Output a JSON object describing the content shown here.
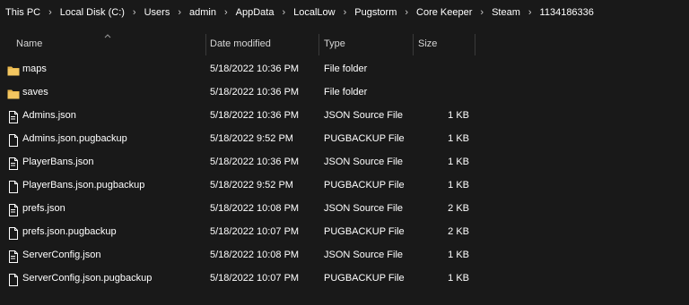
{
  "breadcrumb": [
    "This PC",
    "Local Disk (C:)",
    "Users",
    "admin",
    "AppData",
    "LocalLow",
    "Pugstorm",
    "Core Keeper",
    "Steam",
    "1134186336"
  ],
  "columns": {
    "name": "Name",
    "date": "Date modified",
    "type": "Type",
    "size": "Size"
  },
  "sort": {
    "column": "name",
    "direction": "ascending"
  },
  "colors": {
    "folder": "#e8b64c",
    "file_outline": "#ffffff",
    "background": "#191919"
  },
  "files": [
    {
      "name": "maps",
      "date": "5/18/2022 10:36 PM",
      "type": "File folder",
      "size": "",
      "icon": "folder-icon"
    },
    {
      "name": "saves",
      "date": "5/18/2022 10:36 PM",
      "type": "File folder",
      "size": "",
      "icon": "folder-icon"
    },
    {
      "name": "Admins.json",
      "date": "5/18/2022 10:36 PM",
      "type": "JSON Source File",
      "size": "1 KB",
      "icon": "json-file-icon"
    },
    {
      "name": "Admins.json.pugbackup",
      "date": "5/18/2022 9:52 PM",
      "type": "PUGBACKUP File",
      "size": "1 KB",
      "icon": "file-icon"
    },
    {
      "name": "PlayerBans.json",
      "date": "5/18/2022 10:36 PM",
      "type": "JSON Source File",
      "size": "1 KB",
      "icon": "json-file-icon"
    },
    {
      "name": "PlayerBans.json.pugbackup",
      "date": "5/18/2022 9:52 PM",
      "type": "PUGBACKUP File",
      "size": "1 KB",
      "icon": "file-icon"
    },
    {
      "name": "prefs.json",
      "date": "5/18/2022 10:08 PM",
      "type": "JSON Source File",
      "size": "2 KB",
      "icon": "json-file-icon"
    },
    {
      "name": "prefs.json.pugbackup",
      "date": "5/18/2022 10:07 PM",
      "type": "PUGBACKUP File",
      "size": "2 KB",
      "icon": "file-icon"
    },
    {
      "name": "ServerConfig.json",
      "date": "5/18/2022 10:08 PM",
      "type": "JSON Source File",
      "size": "1 KB",
      "icon": "json-file-icon"
    },
    {
      "name": "ServerConfig.json.pugbackup",
      "date": "5/18/2022 10:07 PM",
      "type": "PUGBACKUP File",
      "size": "1 KB",
      "icon": "file-icon"
    }
  ]
}
